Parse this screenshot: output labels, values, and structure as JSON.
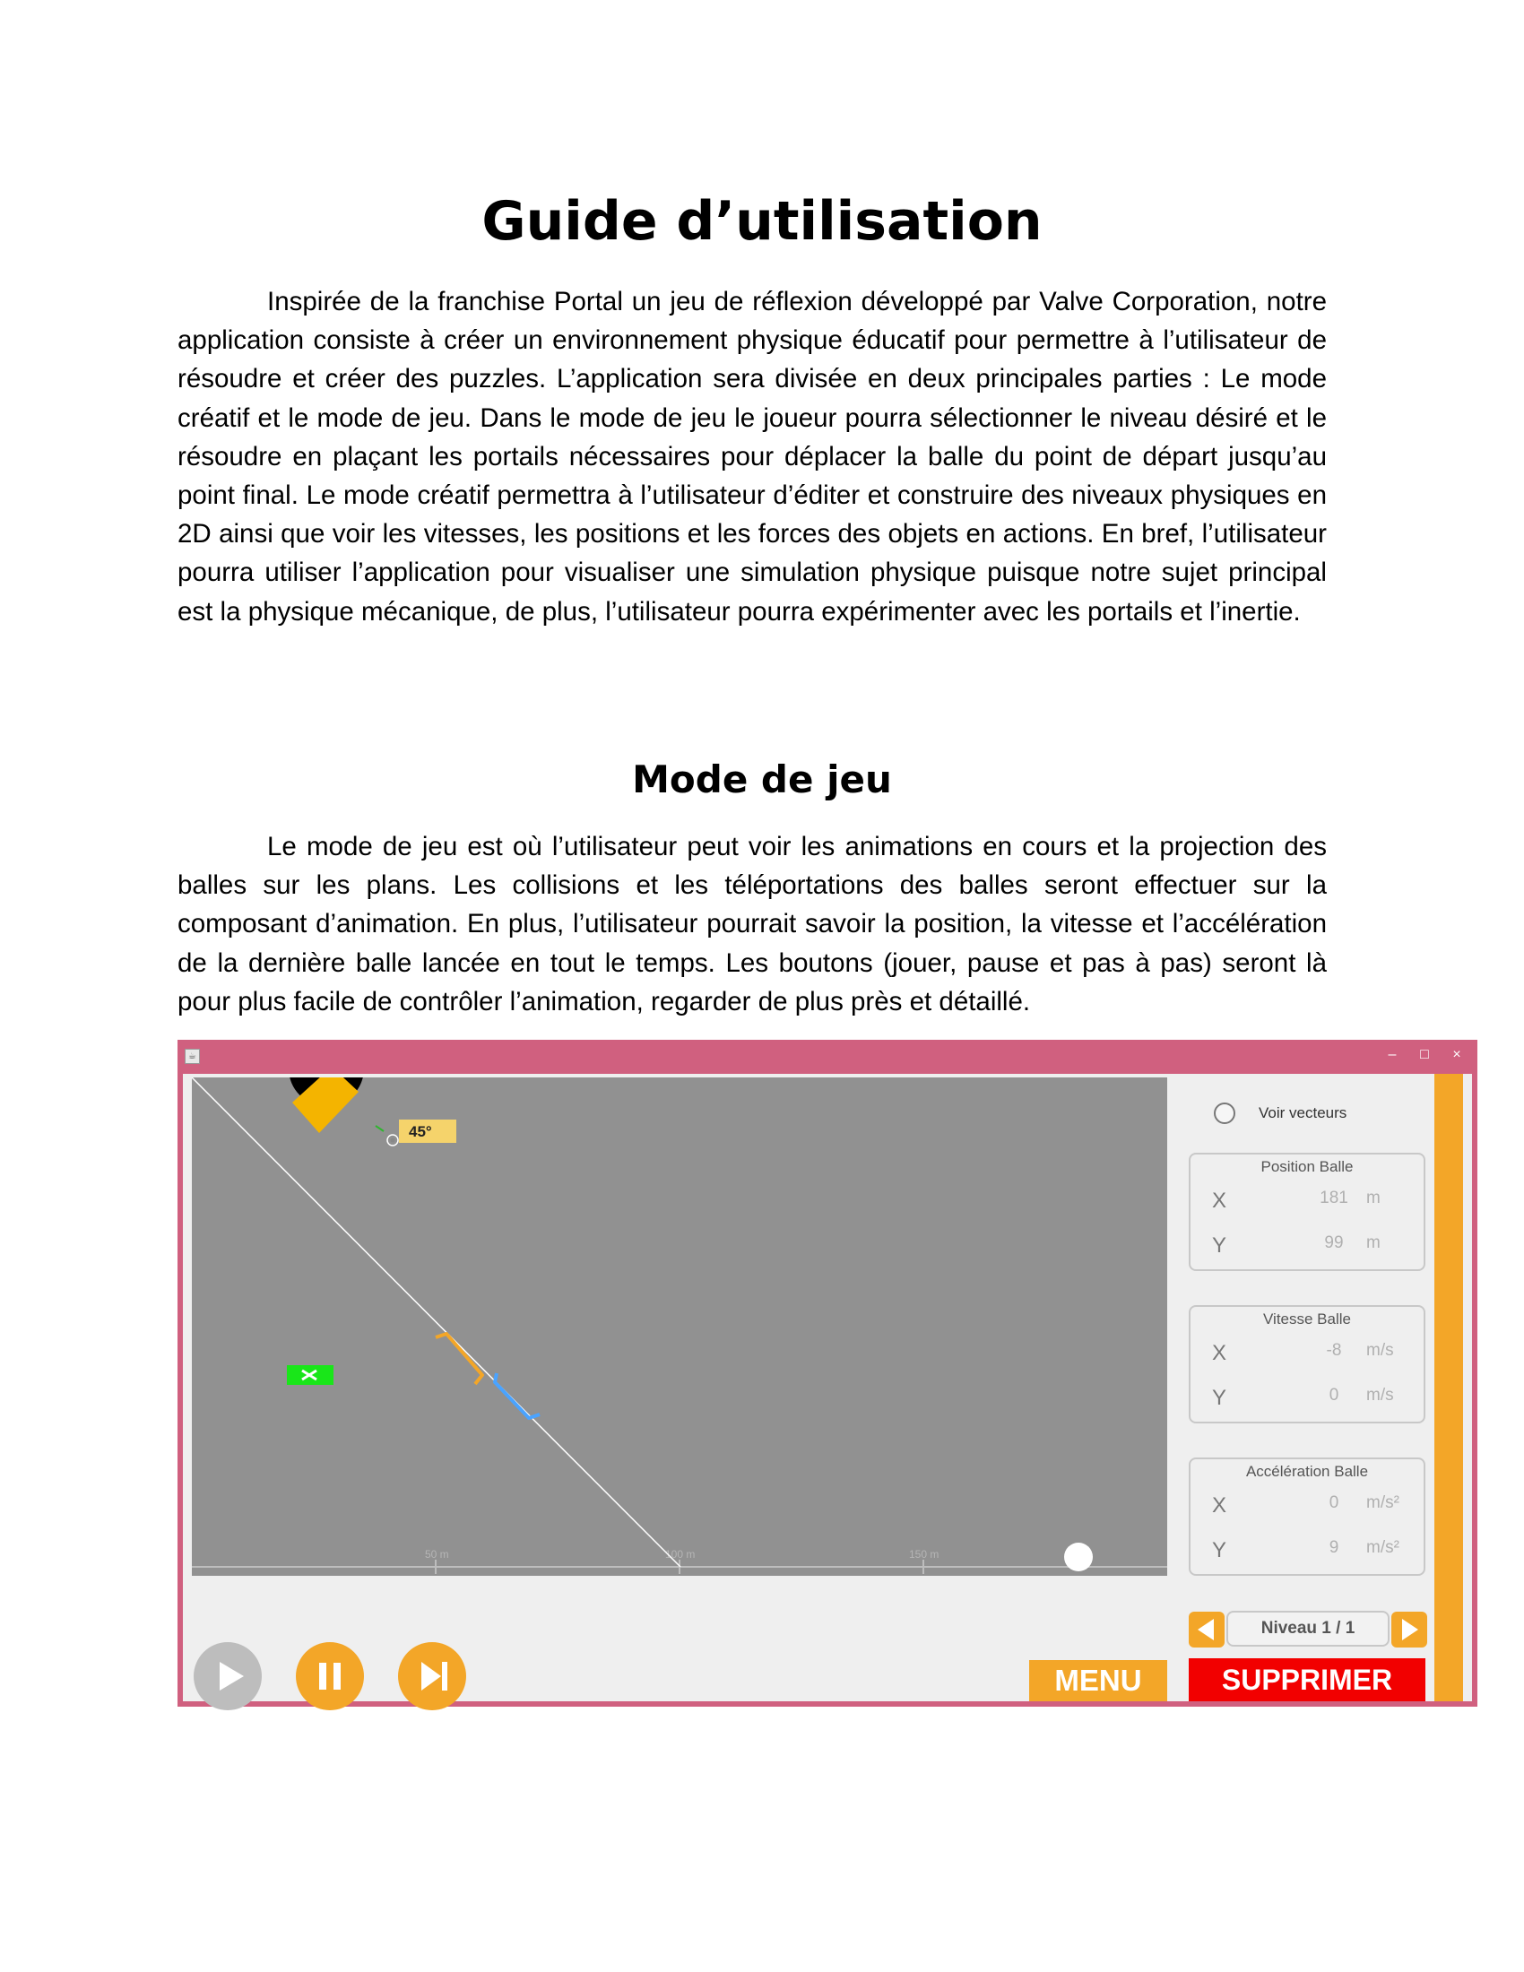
{
  "document": {
    "title": "Guide d’utilisation",
    "intro_paragraph": "Inspirée de la franchise Portal un jeu de réflexion développé par Valve Corporation, notre application consiste à créer un environnement physique éducatif pour permettre à l’utilisateur de résoudre et créer des puzzles. L’application sera divisée en deux principales parties : Le mode créatif et le mode de jeu. Dans le mode de jeu le joueur pourra sélectionner le niveau désiré et le résoudre en plaçant les portails nécessaires pour déplacer la balle du point de départ jusqu’au point final. Le mode créatif permettra à l’utilisateur d’éditer et construire des niveaux physiques en 2D ainsi que voir les vitesses, les positions et les forces des objets en actions. En bref, l’utilisateur pourra utiliser l’application pour visualiser une simulation physique puisque notre sujet principal est la physique mécanique, de plus, l’utilisateur pourra expérimenter avec les portails et l’inertie.",
    "section_title": "Mode de jeu",
    "section_paragraph": "Le mode de jeu est où l’utilisateur peut voir les animations en cours et la projection des balles sur les plans. Les collisions et les téléportations des balles seront effectuer sur la composant d’animation. En plus, l’utilisateur pourrait savoir la position, la vitesse et l’accélération de la dernière balle lancée en tout le temps. Les boutons (jouer, pause et pas à pas) seront là pour plus facile de contrôler l’animation, regarder de plus près et détaillé."
  },
  "app": {
    "window_buttons": {
      "minimize": "–",
      "maximize": "□",
      "close": "×"
    },
    "canvas": {
      "angle_label": "45°",
      "ruler_ticks": [
        "50 m",
        "100 m",
        "150 m"
      ]
    },
    "vectors_toggle_label": "Voir vecteurs",
    "position": {
      "title": "Position Balle",
      "x_label": "X",
      "y_label": "Y",
      "x": "181",
      "y": "99",
      "x_unit": "m",
      "y_unit": "m"
    },
    "velocity": {
      "title": "Vitesse Balle",
      "x_label": "X",
      "y_label": "Y",
      "x": "-8",
      "y": "0",
      "x_unit": "m/s",
      "y_unit": "m/s"
    },
    "acceleration": {
      "title": "Accélération Balle",
      "x_label": "X",
      "y_label": "Y",
      "x": "0",
      "y": "9",
      "x_unit": "m/s²",
      "y_unit": "m/s²"
    },
    "level_label": "Niveau 1 / 1",
    "menu_label": "MENU",
    "delete_label": "SUPPRIMER",
    "colors": {
      "window_frame": "#d0607f",
      "accent_orange": "#f3a628",
      "delete_red": "#f20000",
      "canvas_gray": "#919191",
      "play_disabled": "#bdbdbd",
      "portal_orange": "#f3a628",
      "portal_blue": "#4aa3ff",
      "target_green": "#19e619"
    },
    "icons": [
      "play-icon",
      "pause-icon",
      "step-icon",
      "arrow-left-icon",
      "arrow-right-icon"
    ]
  }
}
